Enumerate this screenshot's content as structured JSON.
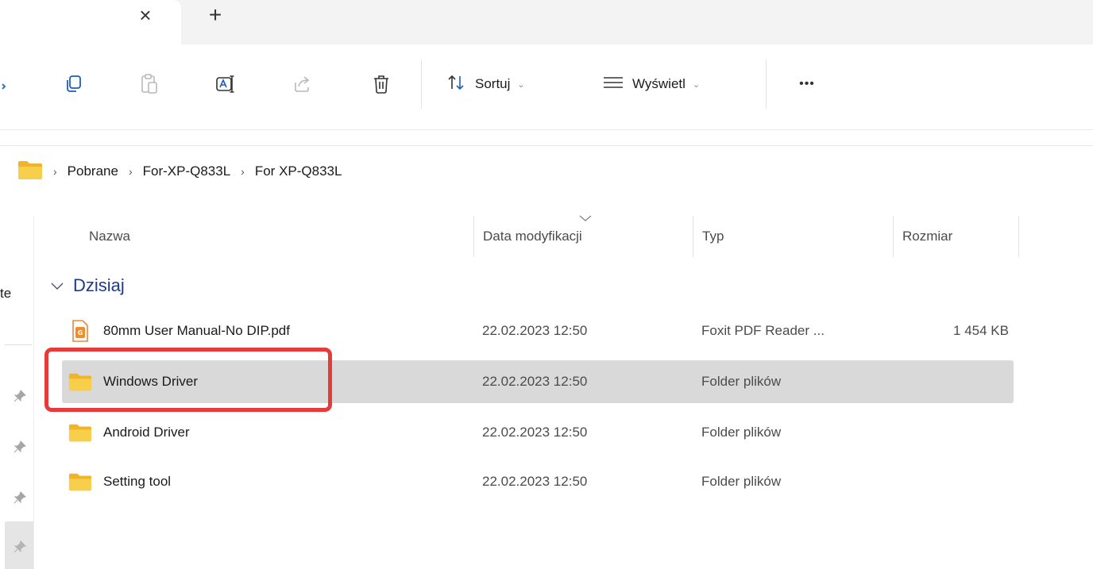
{
  "tabs": {
    "close_icon": "×",
    "new_tab_icon": "+"
  },
  "toolbar": {
    "buttons": [
      {
        "icon": "copy-icon"
      },
      {
        "icon": "paste-icon"
      },
      {
        "icon": "rename-icon"
      },
      {
        "icon": "share-icon"
      },
      {
        "icon": "delete-icon"
      }
    ],
    "sort_label": "Sortuj",
    "view_label": "Wyświetl",
    "more_label": "•••"
  },
  "breadcrumb": {
    "items": [
      "Pobrane",
      "For-XP-Q833L",
      "For XP-Q833L"
    ]
  },
  "sidebar": {
    "partial_text": "te"
  },
  "columns": {
    "name": "Nazwa",
    "date": "Data modyfikacji",
    "type": "Typ",
    "size": "Rozmiar"
  },
  "group": {
    "label": "Dzisiaj"
  },
  "files": [
    {
      "name": "80mm User Manual-No DIP.pdf",
      "date": "22.02.2023 12:50",
      "type": "Foxit PDF Reader ...",
      "size": "1 454 KB",
      "icon": "pdf-file-icon"
    },
    {
      "name": "Windows Driver",
      "date": "22.02.2023 12:50",
      "type": "Folder plików",
      "size": "",
      "icon": "folder-icon"
    },
    {
      "name": "Android Driver",
      "date": "22.02.2023 12:50",
      "type": "Folder plików",
      "size": "",
      "icon": "folder-icon"
    },
    {
      "name": "Setting tool",
      "date": "22.02.2023 12:50",
      "type": "Folder plików",
      "size": "",
      "icon": "folder-icon"
    }
  ],
  "colors": {
    "accent": "#1f3a8a",
    "folder": "#f4c531",
    "selection": "#d9d9d9",
    "annotation": "#e53b3b"
  }
}
